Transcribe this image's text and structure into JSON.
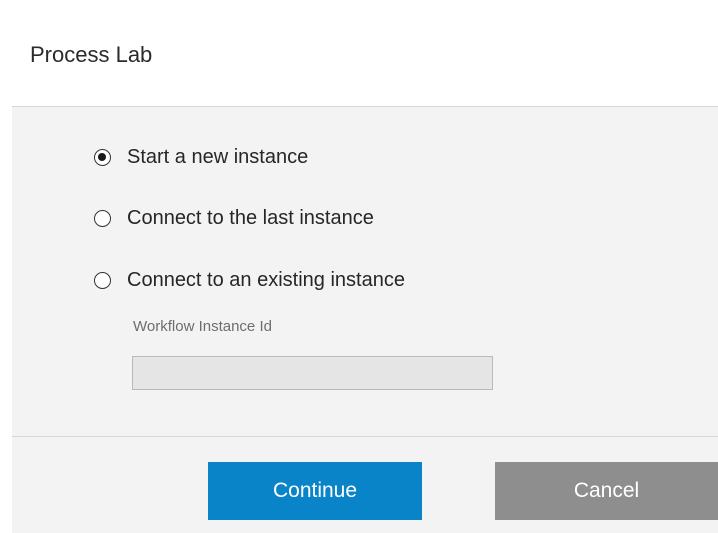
{
  "dialog": {
    "title": "Process Lab"
  },
  "options": [
    {
      "label": "Start a new instance",
      "selected": true
    },
    {
      "label": "Connect to the last instance",
      "selected": false
    },
    {
      "label": "Connect to an existing instance",
      "selected": false
    }
  ],
  "instance_field": {
    "label": "Workflow Instance Id",
    "value": "",
    "placeholder": ""
  },
  "buttons": {
    "continue_label": "Continue",
    "cancel_label": "Cancel"
  },
  "colors": {
    "continue_bg": "#0a84c8",
    "cancel_bg": "#8e8e8e",
    "body_bg": "#f3f3f3"
  },
  "icons": {
    "radio_selected": "radio-selected-icon",
    "radio_unselected": "radio-unselected-icon"
  }
}
